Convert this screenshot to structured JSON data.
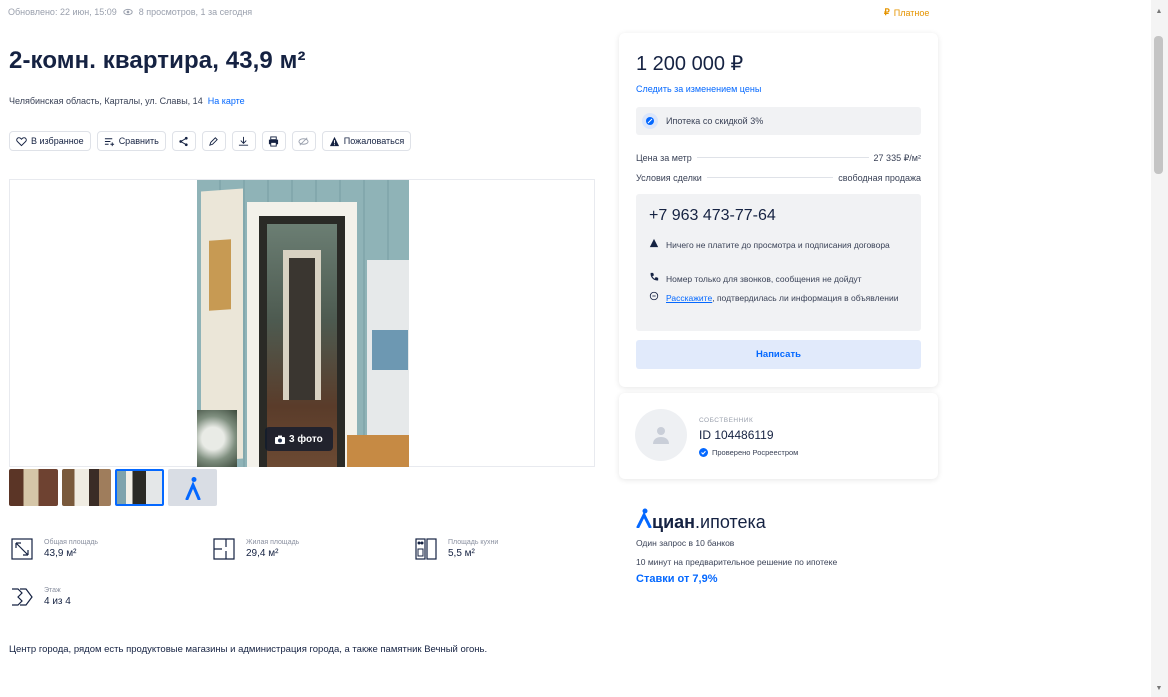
{
  "meta": {
    "updated": "Обновлено: 22 июн, 15:09",
    "views": "8 просмотров, 1 за сегодня",
    "paid_label": "Платное",
    "paid_symbol": "₽"
  },
  "listing": {
    "title": "2-комн. квартира, 43,9 м²",
    "address": "Челябинская область, Карталы, ул. Славы, 14",
    "map_link": "На карте",
    "description": "Центр города, рядом есть продуктовые магазины и администрация города, а также памятник Вечный огонь."
  },
  "actions": {
    "favorite": "В избранное",
    "compare": "Сравнить",
    "complain": "Пожаловаться"
  },
  "gallery": {
    "photo_count": "3 фото"
  },
  "specs": {
    "total_label": "Общая площадь",
    "total_value": "43,9 м²",
    "living_label": "Жилая площадь",
    "living_value": "29,4 м²",
    "kitchen_label": "Площадь кухни",
    "kitchen_value": "5,5 м²",
    "floor_label": "Этаж",
    "floor_value": "4 из 4"
  },
  "price_card": {
    "price": "1 200 000 ₽",
    "follow": "Следить за изменением цены",
    "mortgage": "Ипотека со скидкой 3%",
    "per_meter_label": "Цена за метр",
    "per_meter_value": "27 335 ₽/м²",
    "terms_label": "Условия сделки",
    "terms_value": "свободная продажа",
    "phone": "+7 963 473-77-64",
    "note1": "Ничего не платите до просмотра и подписания договора",
    "note2": "Номер только для звонков, сообщения не дойдут",
    "note3_link": "Расскажите",
    "note3_rest": ", подтвердилась ли информация в объявлении",
    "write": "Написать"
  },
  "owner": {
    "type": "СОБСТВЕННИК",
    "id": "ID 104486119",
    "verified": "Проверено Росреестром"
  },
  "cian": {
    "logo_bold": "циан",
    "logo_rest": ".ипотека",
    "line1": "Один запрос в 10 банков",
    "line2": "10 минут на предварительное решение по ипотеке",
    "rates": "Ставки от 7,9%"
  },
  "colors": {
    "accent": "#0468ff",
    "text": "#152242",
    "paid": "#e59400"
  }
}
